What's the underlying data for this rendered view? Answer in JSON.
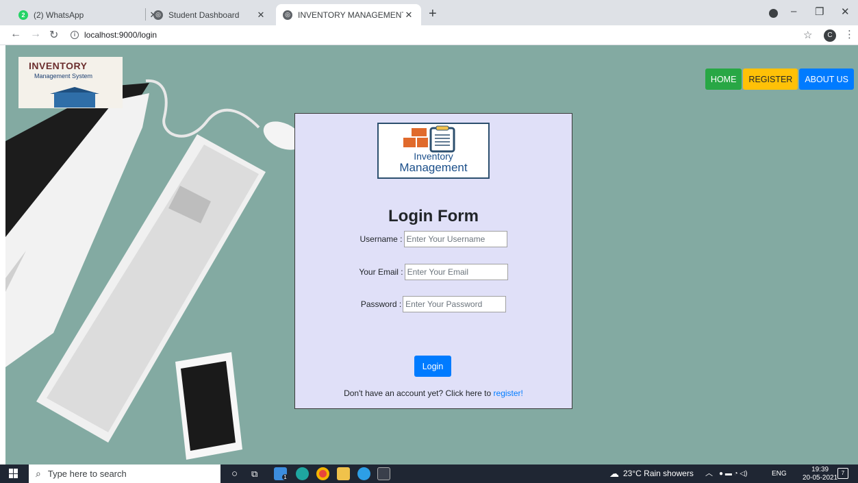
{
  "browser": {
    "tabs": [
      {
        "title": "(2) WhatsApp",
        "active": false
      },
      {
        "title": "Student Dashboard",
        "active": false
      },
      {
        "title": "INVENTORY MANAGEMENT SYS",
        "active": true
      }
    ],
    "url": "localhost:9000/login",
    "profile_initial": "C"
  },
  "site": {
    "logo_title": "INVENTORY",
    "logo_subtitle": "Management System",
    "nav": {
      "home": "HOME",
      "register": "REGISTER",
      "about": "ABOUT US"
    },
    "colors": {
      "home": "#28a745",
      "register": "#ffc107",
      "about": "#007bff",
      "page_bg": "#83aaa2",
      "card_bg": "#e0e0f8"
    }
  },
  "login": {
    "card_logo_line1": "Inventory",
    "card_logo_line2": "Management",
    "title": "Login Form",
    "username_label": "Username :",
    "username_placeholder": "Enter Your Username",
    "email_label": "Your Email :",
    "email_placeholder": "Enter Your Email",
    "password_label": "Password :",
    "password_placeholder": "Enter Your Password",
    "submit": "Login",
    "register_prompt": "Don't have an account yet? Click here to",
    "register_link": "register!"
  },
  "taskbar": {
    "search_placeholder": "Type here to search",
    "weather": "23°C  Rain showers",
    "language": "ENG",
    "time": "19:39",
    "date": "20-05-2021",
    "notification_count": "7",
    "mail_badge": "1"
  }
}
